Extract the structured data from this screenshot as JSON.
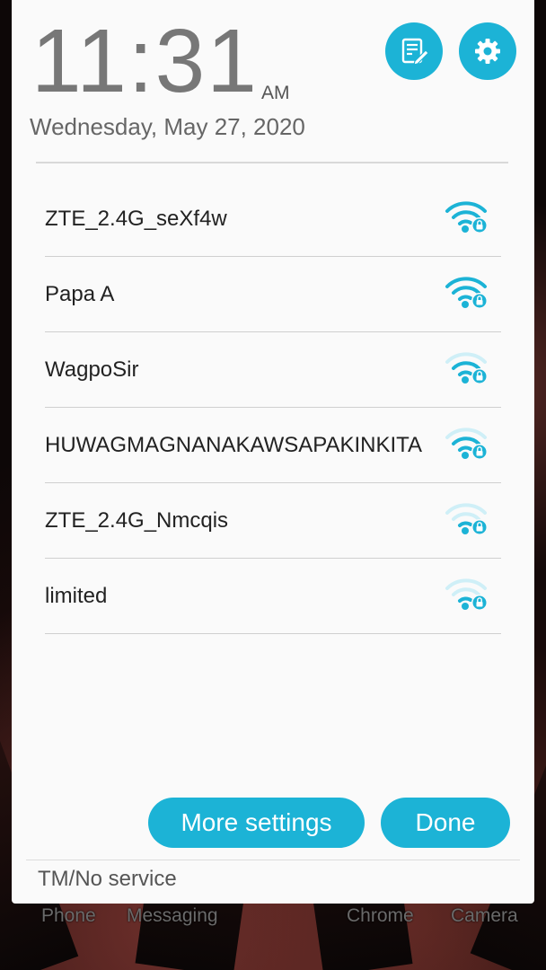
{
  "lockscreen": {
    "time": "11:31",
    "ampm": "AM",
    "date": "Wednesday, May 27, 2020"
  },
  "header_buttons": {
    "edit_icon": "edit-note-icon",
    "settings_icon": "gear-icon"
  },
  "wifi_networks": [
    {
      "ssid": "ZTE_2.4G_seXf4w",
      "icon": "wifi-locked-icon",
      "signal": 3
    },
    {
      "ssid": "Papa A",
      "icon": "wifi-locked-icon",
      "signal": 3
    },
    {
      "ssid": "WagpoSir",
      "icon": "wifi-locked-icon",
      "signal": 2
    },
    {
      "ssid": "HUWAGMAGNANAKAWSAPAKINKITA",
      "icon": "wifi-locked-icon",
      "signal": 2
    },
    {
      "ssid": "ZTE_2.4G_Nmcqis",
      "icon": "wifi-locked-icon",
      "signal": 1
    },
    {
      "ssid": "limited",
      "icon": "wifi-locked-icon",
      "signal": 1
    }
  ],
  "actions": {
    "more_settings": "More settings",
    "done": "Done"
  },
  "status": {
    "carrier": "TM/No service"
  },
  "dock": {
    "phone": "Phone",
    "messaging": "Messaging",
    "chrome": "Chrome",
    "camera": "Camera"
  },
  "colors": {
    "accent": "#1cb3d6",
    "wifi_active": "#1cb3d6",
    "wifi_inactive": "#cfeff7"
  }
}
